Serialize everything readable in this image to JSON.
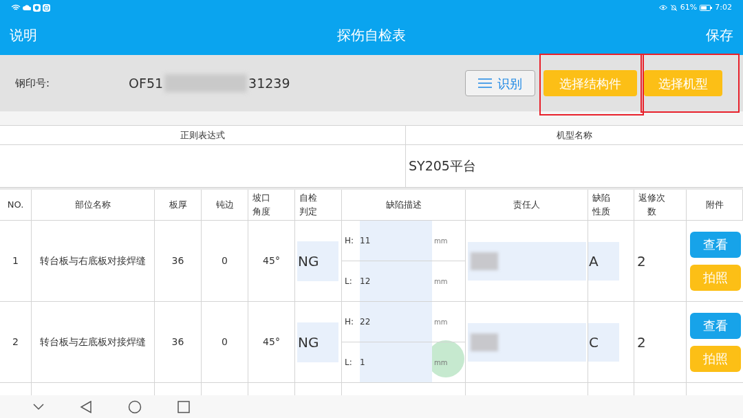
{
  "status_bar": {
    "battery": "61%",
    "time": "7:02"
  },
  "title_bar": {
    "left": "说明",
    "title": "探伤自检表",
    "right": "保存"
  },
  "stamp": {
    "label": "钢印号:",
    "value_start": "OF51",
    "value_end": "31239",
    "redacted": true
  },
  "buttons": [
    {
      "kind": "outline",
      "label": "识别",
      "highlighted": false
    },
    {
      "kind": "primary",
      "label": "选择结构件",
      "highlighted": true
    },
    {
      "kind": "primary",
      "label": "选择机型",
      "highlighted": true
    }
  ],
  "info_table": {
    "columns": [
      "正则表达式",
      "机型名称"
    ],
    "model_name": "SY205平台"
  },
  "table": {
    "columns": [
      "NO.",
      "部位名称",
      "板厚",
      "钝边",
      "坡口角度",
      "自检判定",
      "缺陷描述",
      "责任人",
      "缺陷性质",
      "返修次数",
      "附件"
    ],
    "rows": [
      {
        "no": "1",
        "part": "转台板与右底板对接焊缝",
        "thickness": "36",
        "blunt_edge": "0",
        "angle": "45°",
        "judgement": "NG",
        "defect": {
          "h_label": "H:",
          "h": "11",
          "h_unit": "mm",
          "l_label": "L:",
          "l": "12",
          "l_unit": "mm"
        },
        "responsible_redacted": true,
        "nature": "A",
        "repairs": "2",
        "actions": [
          "查看",
          "拍照"
        ],
        "touched": false
      },
      {
        "no": "2",
        "part": "转台板与左底板对接焊缝",
        "thickness": "36",
        "blunt_edge": "0",
        "angle": "45°",
        "judgement": "NG",
        "defect": {
          "h_label": "H:",
          "h": "22",
          "h_unit": "mm",
          "l_label": "L:",
          "l": "1",
          "l_unit": "mm"
        },
        "responsible_redacted": true,
        "nature": "C",
        "repairs": "2",
        "actions": [
          "查看",
          "拍照"
        ],
        "touched": true
      }
    ]
  }
}
